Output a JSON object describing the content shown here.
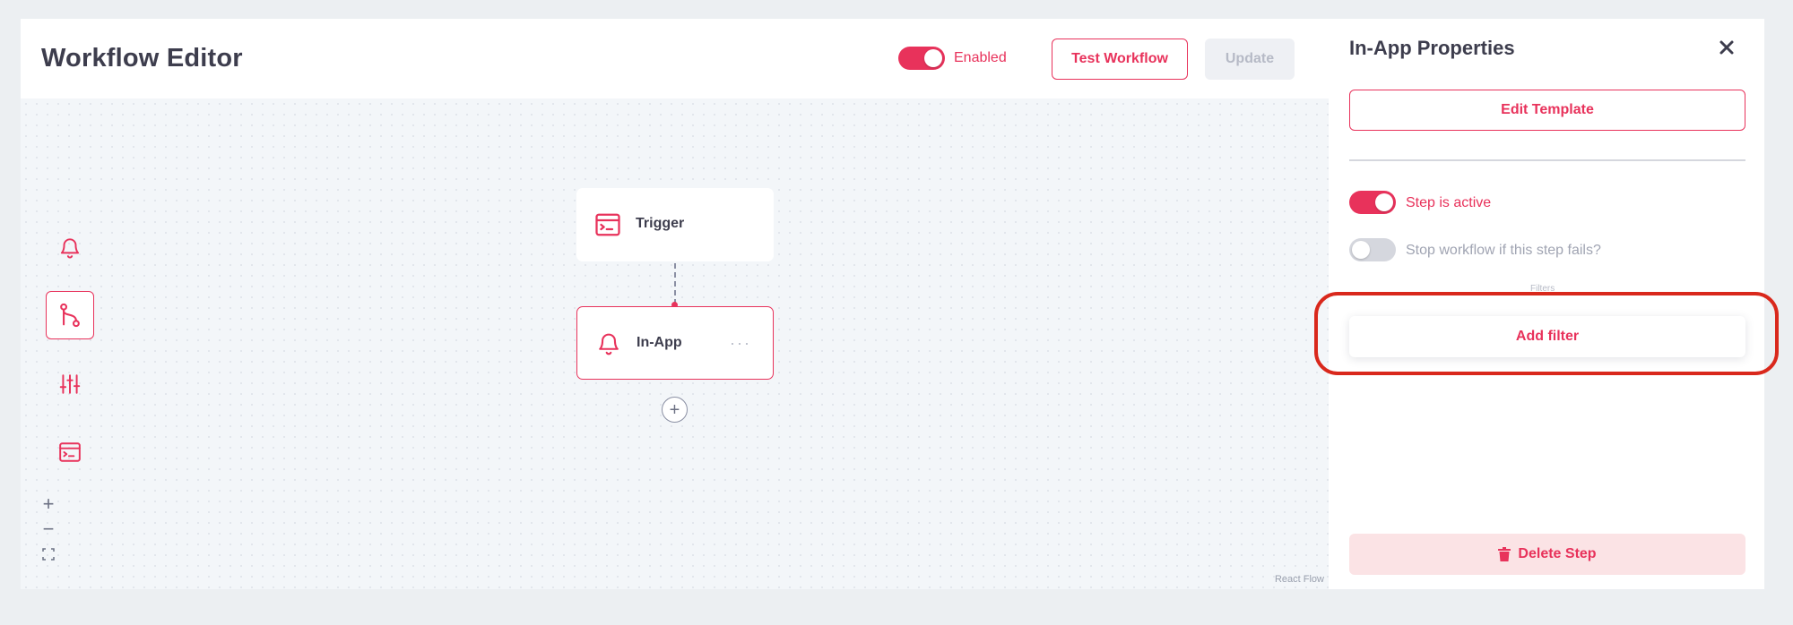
{
  "header": {
    "title": "Workflow Editor",
    "enabled_label": "Enabled",
    "test_label": "Test Workflow",
    "update_label": "Update"
  },
  "canvas": {
    "nodes": [
      {
        "label": "Trigger",
        "icon": "terminal-window-icon"
      },
      {
        "label": "In-App",
        "icon": "bell-icon",
        "menu": "···"
      }
    ],
    "add_node": "+",
    "zoom_in": "+",
    "zoom_out": "−",
    "attribution": "React Flow"
  },
  "sidebar": {
    "tools": [
      "bell-icon",
      "git-branch-icon",
      "sliders-icon",
      "terminal-window-icon"
    ]
  },
  "panel": {
    "title": "In-App Properties",
    "edit_template_label": "Edit Template",
    "step_active_label": "Step is active",
    "stop_workflow_label": "Stop workflow if this step fails?",
    "filters_label": "Filters",
    "add_filter_label": "Add filter",
    "delete_label": "Delete Step"
  },
  "colors": {
    "accent": "#e8325b",
    "highlight": "#d9281c"
  }
}
